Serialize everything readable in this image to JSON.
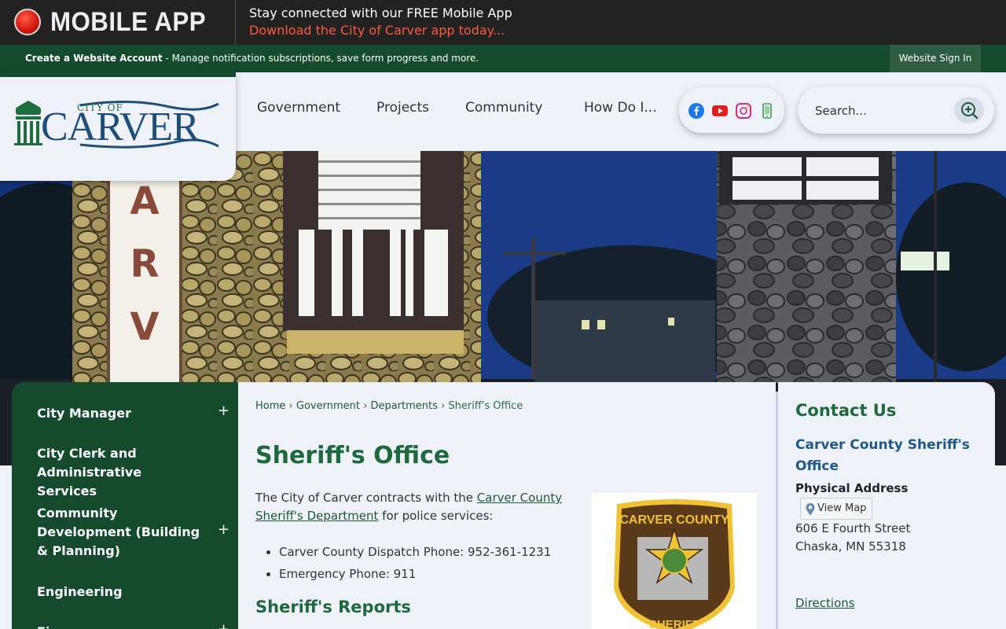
{
  "appbar": {
    "title": "MOBILE APP",
    "promo_line1": "Stay connected with our FREE Mobile App",
    "promo_line2": "Download the City of Carver app today..."
  },
  "accountbar": {
    "create_link": "Create a Website Account",
    "description": " - Manage notification subscriptions, save form progress and more.",
    "signin_label": "Website Sign In"
  },
  "logo": {
    "small_text": "CITY OF",
    "big_text": "CARVER"
  },
  "nav": [
    {
      "label": "Government"
    },
    {
      "label": "Projects"
    },
    {
      "label": "Community"
    },
    {
      "label": "How Do I..."
    }
  ],
  "social": [
    "facebook-icon",
    "youtube-icon",
    "instagram-icon",
    "mobile-phone-icon"
  ],
  "search": {
    "placeholder": "Search..."
  },
  "sidebar": {
    "items": [
      {
        "label": "City Manager",
        "expandable": true
      },
      {
        "label": "City Clerk and Administrative Services",
        "expandable": false
      },
      {
        "label": "Community Development (Building & Planning)",
        "expandable": true
      },
      {
        "label": "Engineering",
        "expandable": false
      },
      {
        "label": "Finance",
        "expandable": true
      }
    ],
    "plus_glyph": "+"
  },
  "breadcrumb": {
    "items": [
      "Home",
      "Government",
      "Departments"
    ],
    "current": "Sheriff's Office",
    "separator": "›"
  },
  "main": {
    "title": "Sheriff's Office",
    "intro_before": "The City of Carver contracts with the ",
    "intro_link": "Carver County Sheriff's Department",
    "intro_after": " for police services:",
    "bullets": [
      "Carver County Dispatch Phone: 952-361-1231",
      "Emergency Phone: 911"
    ],
    "reports_title": "Sheriff's Reports",
    "badge_top": "CARVER COUNTY",
    "badge_bottom": "SHERIFF"
  },
  "contact": {
    "title": "Contact Us",
    "org": "Carver County Sheriff's Office",
    "physical_label": "Physical Address",
    "view_map": "View Map",
    "address_line1": "606 E Fourth Street",
    "address_line2": "Chaska, MN 55318",
    "directions": "Directions"
  },
  "colors": {
    "brand_green": "#144a2e",
    "heading_green": "#1d6a3e",
    "link_blue": "#1d5a8a",
    "promo_orange": "#ff5a3a"
  }
}
